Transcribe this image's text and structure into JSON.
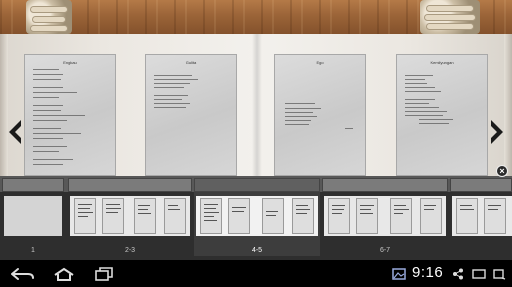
{
  "book": {
    "pages": [
      {
        "title": "Engkau"
      },
      {
        "title": "Gulita"
      },
      {
        "title": "Ego"
      },
      {
        "title": "Kemilyungan"
      }
    ]
  },
  "thumbnails": [
    {
      "label": "1",
      "active": false
    },
    {
      "label": "2-3",
      "active": false
    },
    {
      "label": "4-5",
      "active": true
    },
    {
      "label": "6-7",
      "active": false
    },
    {
      "label": "",
      "active": false
    }
  ],
  "status_bar": {
    "time": "9:16"
  },
  "icons": {
    "prev": "chevron-left-icon",
    "next": "chevron-right-icon",
    "close": "close-icon",
    "back": "back-icon",
    "home": "home-icon",
    "recent": "recent-apps-icon"
  },
  "colors": {
    "wood": "#9b6438",
    "strip": "#2e2e2e"
  }
}
